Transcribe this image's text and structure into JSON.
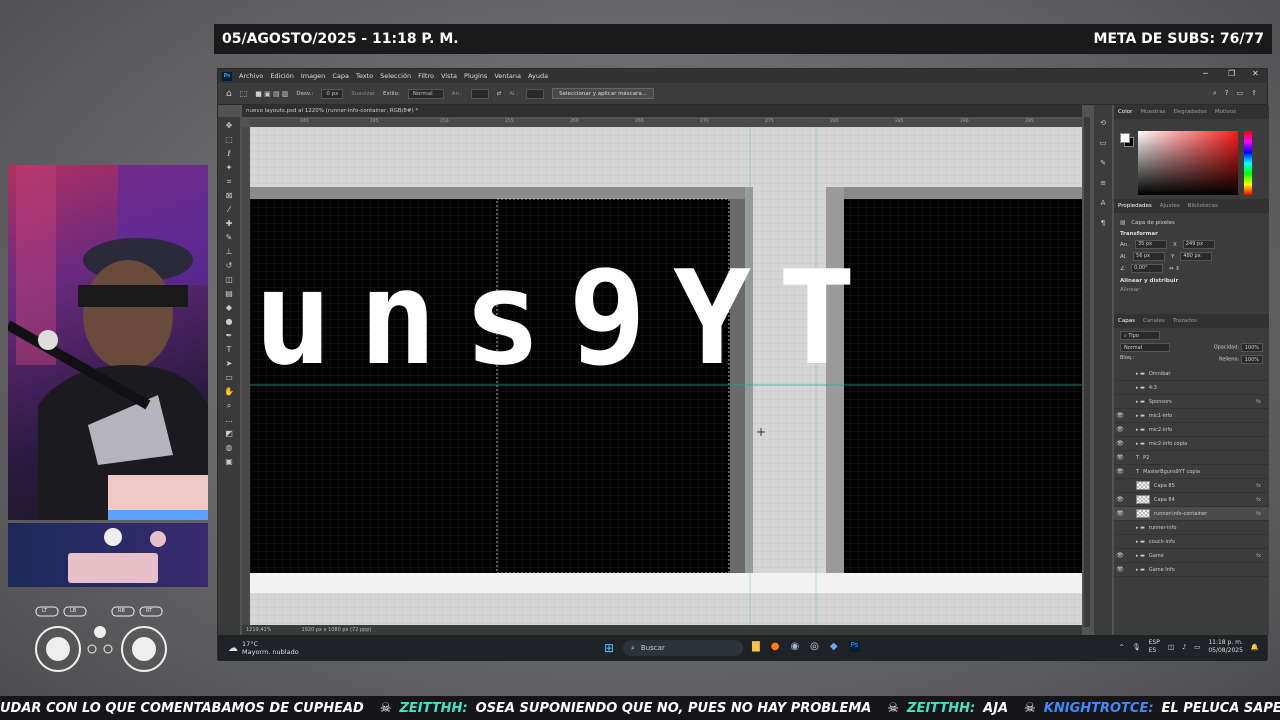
{
  "overlay": {
    "date_time": "05/AGOSTO/2025 - 11:18 P. M.",
    "subs_goal": "META DE SUBS: 76/77"
  },
  "photoshop": {
    "logo": "Ps",
    "menu": [
      "Archivo",
      "Edición",
      "Imagen",
      "Capa",
      "Texto",
      "Selección",
      "Filtro",
      "Vista",
      "Plugins",
      "Ventana",
      "Ayuda"
    ],
    "window_controls": [
      "─",
      "❐",
      "✕"
    ],
    "options": {
      "feather_label": "Desv.:",
      "feather_value": "0 px",
      "smooth_label": "Suavizar",
      "style_label": "Estilo:",
      "style_value": "Normal",
      "width_label": "An.:",
      "height_label": "Al.:",
      "select_mask_button": "Seleccionar y aplicar máscara..."
    },
    "document_tab": "nuevo layouts.psd al 1220% (runner-info-container, RGB/8#) *",
    "ruler_ticks": [
      "240",
      "245",
      "250",
      "255",
      "260",
      "265",
      "270",
      "275",
      "280",
      "285",
      "290",
      "295"
    ],
    "canvas_text": "uns9YT",
    "status": {
      "zoom": "1219,41%",
      "doc_size": "1920 px x 1080 px (72 ppp)"
    },
    "color_panel_tabs": [
      "Color",
      "Muestras",
      "Degradados",
      "Motivos"
    ],
    "properties_tabs": [
      "Propiedades",
      "Ajustes",
      "Bibliotecas"
    ],
    "properties": {
      "layer_type": "Capa de píxeles",
      "transform_header": "Transformar",
      "w_label": "An.",
      "w_value": "35 px",
      "x_label": "X",
      "x_value": "249 px",
      "h_label": "Al.",
      "h_value": "56 px",
      "y_label": "Y",
      "y_value": "480 px",
      "angle_value": "0,00°",
      "align_header": "Alinear y distribuir",
      "align_sub": "Alinear:"
    },
    "layers_tabs": [
      "Capas",
      "Canales",
      "Trazados"
    ],
    "layers_filter": "Tipo",
    "blend_mode": "Normal",
    "opacity_label": "Opacidad:",
    "opacity_value": "100%",
    "lock_label": "Bloq.:",
    "fill_label": "Relleno:",
    "fill_value": "100%",
    "layers": [
      {
        "name": "Omnibar",
        "type": "folder",
        "eye": false,
        "fx": false
      },
      {
        "name": "4:3",
        "type": "folder",
        "eye": false,
        "fx": false
      },
      {
        "name": "Sponsors",
        "type": "folder",
        "eye": false,
        "fx": true
      },
      {
        "name": "mic1-info",
        "type": "folder",
        "eye": true,
        "fx": false
      },
      {
        "name": "mic2-info",
        "type": "folder",
        "eye": true,
        "fx": false
      },
      {
        "name": "mic2-info copia",
        "type": "folder",
        "eye": true,
        "fx": false
      },
      {
        "name": "P2",
        "type": "text",
        "eye": true,
        "fx": false
      },
      {
        "name": "MasterBguns9YT copia",
        "type": "text",
        "eye": true,
        "fx": false
      },
      {
        "name": "Capa 85",
        "type": "pixel",
        "eye": false,
        "fx": true
      },
      {
        "name": "Capa 84",
        "type": "pixel",
        "eye": true,
        "fx": true
      },
      {
        "name": "runner-info-container",
        "type": "pixel",
        "eye": true,
        "fx": true,
        "selected": true
      },
      {
        "name": "runner-info",
        "type": "folder",
        "eye": false,
        "fx": false
      },
      {
        "name": "couch-info",
        "type": "folder",
        "eye": false,
        "fx": false
      },
      {
        "name": "Game",
        "type": "folder",
        "eye": true,
        "fx": true
      },
      {
        "name": "Game Info",
        "type": "folder",
        "eye": true,
        "fx": false
      }
    ]
  },
  "taskbar": {
    "weather_temp": "17°C",
    "weather_desc": "Mayorm. nublado",
    "search_placeholder": "Buscar",
    "lang_top": "ESP",
    "lang_bottom": "ES",
    "time": "11:18 p. m.",
    "date": "05/08/2025"
  },
  "controller_buttons": [
    "LT",
    "LB",
    "RB",
    "RT"
  ],
  "ticker": {
    "msg1": "UDAR CON LO QUE COMENTABAMOS DE CUPHEAD",
    "user2": "ZEITTHH:",
    "msg2": "OSEA SUPONIENDO QUE NO, PUES NO HAY PROBLEMA",
    "user3": "ZEITTHH:",
    "msg3": "AJA",
    "user4": "KNIGHTROTCE:",
    "msg4": "EL PELUCA SAPEEEE"
  }
}
